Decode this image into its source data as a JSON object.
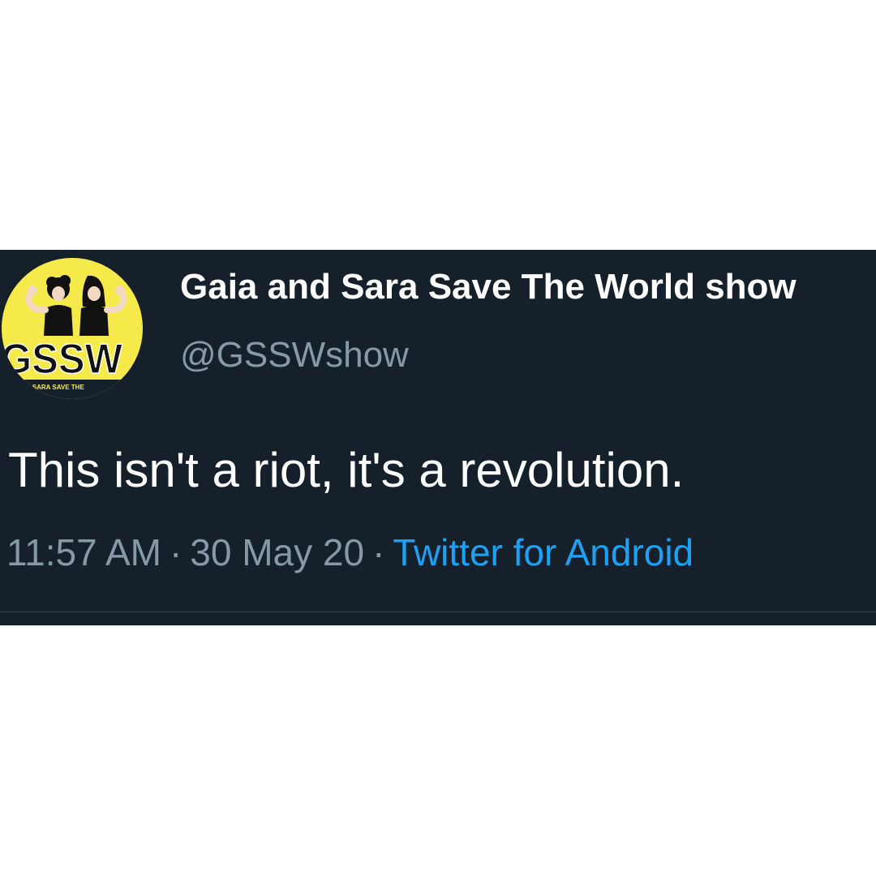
{
  "tweet": {
    "display_name": "Gaia and Sara Save The World show",
    "handle": "@GSSWshow",
    "text": "This isn't a riot, it's a revolution.",
    "time": "11:57 AM",
    "date": "30 May 20",
    "separator": "·",
    "source": "Twitter for Android"
  },
  "avatar": {
    "icon": "gssw-logo-avatar",
    "logo_text": "GSSW",
    "ring_text": "AND SARA SAVE THE"
  },
  "colors": {
    "page_background": "#ffffff",
    "card_background": "#15202b",
    "primary_text": "#ffffff",
    "secondary_text": "#8899a6",
    "link": "#1da1f2",
    "avatar_yellow": "#f6e94a"
  }
}
